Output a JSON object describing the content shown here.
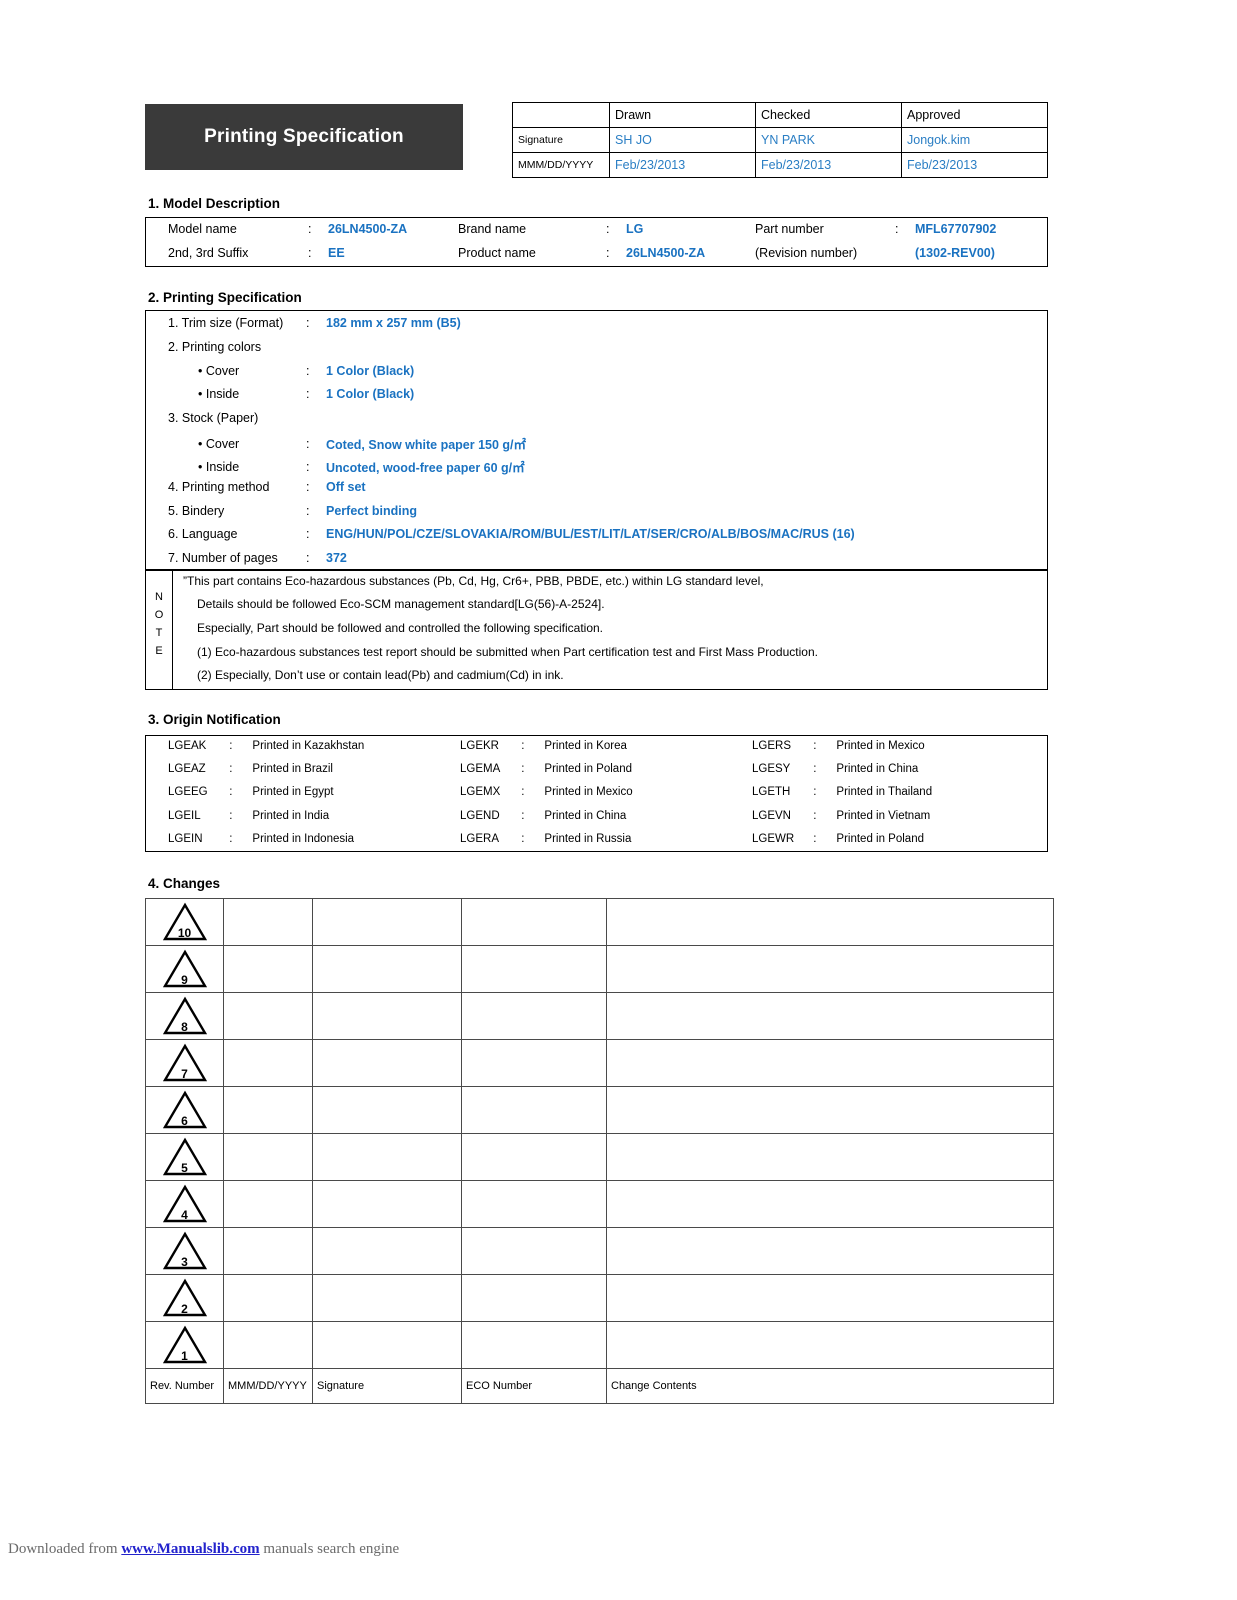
{
  "header": {
    "title": "Printing Specification",
    "signature_table": {
      "columns": [
        "Drawn",
        "Checked",
        "Approved"
      ],
      "rows": [
        {
          "label": "Signature",
          "values": [
            "SH JO",
            "YN PARK",
            "Jongok.kim"
          ]
        },
        {
          "label": "MMM/DD/YYYY",
          "values": [
            "Feb/23/2013",
            "Feb/23/2013",
            "Feb/23/2013"
          ]
        }
      ]
    }
  },
  "sections": {
    "model_description": {
      "title": "1. Model Description",
      "fields": [
        {
          "label": "Model name",
          "colon": ":",
          "value": "26LN4500-ZA"
        },
        {
          "label": "Brand name",
          "colon": ":",
          "value": "LG"
        },
        {
          "label": "Part number",
          "colon": ":",
          "value": "MFL67707902"
        },
        {
          "label": "2nd, 3rd Suffix",
          "colon": ":",
          "value": "EE"
        },
        {
          "label": "Product name",
          "colon": ":",
          "value": "26LN4500-ZA"
        },
        {
          "label": "(Revision number)",
          "colon": "",
          "value": "(1302-REV00)"
        }
      ]
    },
    "printing_specification": {
      "title": "2. Printing Specification",
      "items": [
        {
          "key": "1. Trim size (Format)",
          "colon": ":",
          "value": "182 mm x 257 mm (B5)",
          "indent": 0
        },
        {
          "key": "2. Printing colors",
          "colon": "",
          "value": "",
          "indent": 0
        },
        {
          "key": "• Cover",
          "colon": ":",
          "value": "1 Color (Black)",
          "indent": 1
        },
        {
          "key": "• Inside",
          "colon": ":",
          "value": "1 Color (Black)",
          "indent": 1
        },
        {
          "key": "3. Stock (Paper)",
          "colon": "",
          "value": "",
          "indent": 0
        },
        {
          "key": "• Cover",
          "colon": ":",
          "value": "Coted, Snow white paper 150 g/㎡",
          "indent": 1
        },
        {
          "key": "• Inside",
          "colon": ":",
          "value": "Uncoted, wood-free paper 60 g/㎡",
          "indent": 1
        },
        {
          "key": "4. Printing method",
          "colon": ":",
          "value": "Off set",
          "indent": 0
        },
        {
          "key": "5. Bindery",
          "colon": ":",
          "value": "Perfect binding",
          "indent": 0
        },
        {
          "key": "6. Language",
          "colon": ":",
          "value": "ENG/HUN/POL/CZE/SLOVAKIA/ROM/BUL/EST/LIT/LAT/SER/CRO/ALB/BOS/MAC/RUS (16)",
          "indent": 0
        },
        {
          "key": "7. Number of pages",
          "colon": ":",
          "value": "372",
          "indent": 0
        }
      ]
    },
    "note": {
      "vertical_label": "NOTE",
      "lines": [
        "”This part contains Eco-hazardous substances (Pb, Cd, Hg, Cr6+, PBB, PBDE, etc.) within LG standard level,",
        "Details should be followed Eco-SCM management standard[LG(56)-A-2524].",
        "Especially, Part should be followed and controlled the following specification.",
        "(1) Eco-hazardous substances test report should be submitted when Part certification test and First Mass Production.",
        "(2) Especially, Don’t use or contain lead(Pb) and cadmium(Cd) in ink."
      ]
    },
    "origin_notification": {
      "title": "3. Origin Notification",
      "entries": [
        {
          "code": "LGEAK",
          "colon": ":",
          "text": "Printed in Kazakhstan"
        },
        {
          "code": "LGEKR",
          "colon": ":",
          "text": "Printed in Korea"
        },
        {
          "code": "LGERS",
          "colon": ":",
          "text": "Printed in Mexico"
        },
        {
          "code": "LGEAZ",
          "colon": ":",
          "text": "Printed in Brazil"
        },
        {
          "code": "LGEMA",
          "colon": ":",
          "text": "Printed in Poland"
        },
        {
          "code": "LGESY",
          "colon": ":",
          "text": "Printed in China"
        },
        {
          "code": "LGEEG",
          "colon": ":",
          "text": "Printed in Egypt"
        },
        {
          "code": "LGEMX",
          "colon": ":",
          "text": "Printed in Mexico"
        },
        {
          "code": "LGETH",
          "colon": ":",
          "text": "Printed in Thailand"
        },
        {
          "code": "LGEIL",
          "colon": ":",
          "text": "Printed in India"
        },
        {
          "code": "LGEND",
          "colon": ":",
          "text": "Printed in China"
        },
        {
          "code": "LGEVN",
          "colon": ":",
          "text": "Printed in Vietnam"
        },
        {
          "code": "LGEIN",
          "colon": ":",
          "text": "Printed in Indonesia"
        },
        {
          "code": "LGERA",
          "colon": ":",
          "text": "Printed in Russia"
        },
        {
          "code": "LGEWR",
          "colon": ":",
          "text": "Printed in Poland"
        }
      ]
    },
    "changes": {
      "title": "4. Changes",
      "revision_numbers": [
        "10",
        "9",
        "8",
        "7",
        "6",
        "5",
        "4",
        "3",
        "2",
        "1"
      ],
      "footer_columns": [
        "Rev. Number",
        "MMM/DD/YYYY",
        "Signature",
        "ECO Number",
        "Change Contents"
      ],
      "rows": [
        {
          "rev": "10",
          "date": "",
          "signature": "",
          "eco": "",
          "contents": ""
        },
        {
          "rev": "9",
          "date": "",
          "signature": "",
          "eco": "",
          "contents": ""
        },
        {
          "rev": "8",
          "date": "",
          "signature": "",
          "eco": "",
          "contents": ""
        },
        {
          "rev": "7",
          "date": "",
          "signature": "",
          "eco": "",
          "contents": ""
        },
        {
          "rev": "6",
          "date": "",
          "signature": "",
          "eco": "",
          "contents": ""
        },
        {
          "rev": "5",
          "date": "",
          "signature": "",
          "eco": "",
          "contents": ""
        },
        {
          "rev": "4",
          "date": "",
          "signature": "",
          "eco": "",
          "contents": ""
        },
        {
          "rev": "3",
          "date": "",
          "signature": "",
          "eco": "",
          "contents": ""
        },
        {
          "rev": "2",
          "date": "",
          "signature": "",
          "eco": "",
          "contents": ""
        },
        {
          "rev": "1",
          "date": "",
          "signature": "",
          "eco": "",
          "contents": ""
        }
      ]
    }
  },
  "footer": {
    "prefix": "Downloaded from ",
    "link": "www.Manualslib.com",
    "suffix": " manuals search engine"
  },
  "colors": {
    "accent_blue": "#1a72c1",
    "signature_blue": "#2a7ec4",
    "header_band": "#3a3a3a",
    "link_blue": "#2222cc",
    "footer_gray": "#6b6b6b"
  }
}
